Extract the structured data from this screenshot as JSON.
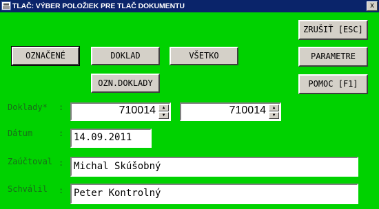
{
  "window": {
    "title": "TLAČ: VÝBER POLOŽIEK PRE TLAČ DOKUMENTU",
    "close_label": "x"
  },
  "buttons": {
    "oznacene": "OZNAČENÉ",
    "doklad": "DOKLAD",
    "vsetko": "VŠETKO",
    "ozn_doklady": "OZN.DOKLADY",
    "zrusit": "ZRUŠIŤ [ESC]",
    "parametre": "PARAMETRE",
    "pomoc": "POMOC [F1]"
  },
  "form": {
    "doklady": {
      "label": "Doklady*",
      "from": "710014",
      "to": "710014"
    },
    "datum": {
      "label": "Dátum",
      "value": "14.09.2011"
    },
    "zauctoval": {
      "label": "Zaúčtoval",
      "value": "Michal Skúšobný"
    },
    "schvalil": {
      "label": "Schválil",
      "value": "Peter Kontrolný"
    }
  },
  "icons": {
    "spin_up": "▲",
    "spin_down": "▼",
    "app_icon": "printer-icon"
  }
}
